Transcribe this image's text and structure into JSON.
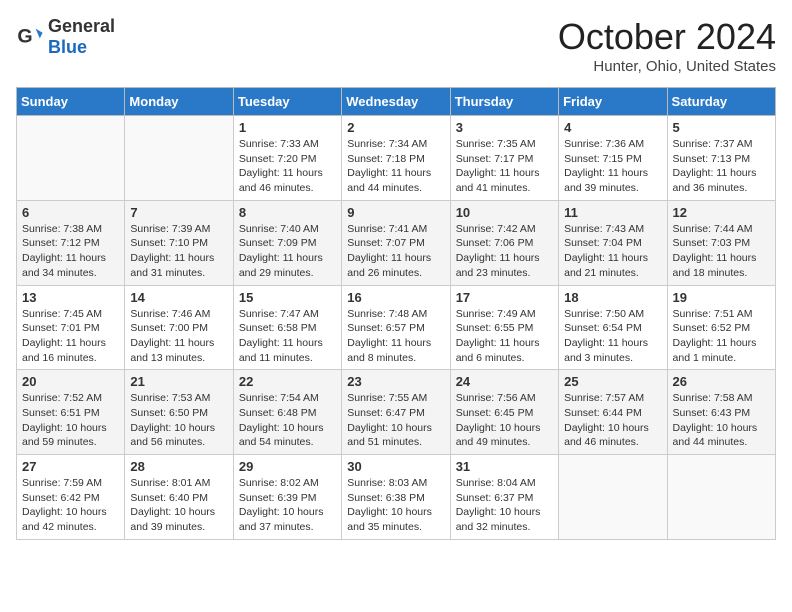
{
  "logo": {
    "general": "General",
    "blue": "Blue"
  },
  "header": {
    "month": "October 2024",
    "location": "Hunter, Ohio, United States"
  },
  "days_of_week": [
    "Sunday",
    "Monday",
    "Tuesday",
    "Wednesday",
    "Thursday",
    "Friday",
    "Saturday"
  ],
  "weeks": [
    [
      {
        "day": "",
        "info": ""
      },
      {
        "day": "",
        "info": ""
      },
      {
        "day": "1",
        "info": "Sunrise: 7:33 AM\nSunset: 7:20 PM\nDaylight: 11 hours and 46 minutes."
      },
      {
        "day": "2",
        "info": "Sunrise: 7:34 AM\nSunset: 7:18 PM\nDaylight: 11 hours and 44 minutes."
      },
      {
        "day": "3",
        "info": "Sunrise: 7:35 AM\nSunset: 7:17 PM\nDaylight: 11 hours and 41 minutes."
      },
      {
        "day": "4",
        "info": "Sunrise: 7:36 AM\nSunset: 7:15 PM\nDaylight: 11 hours and 39 minutes."
      },
      {
        "day": "5",
        "info": "Sunrise: 7:37 AM\nSunset: 7:13 PM\nDaylight: 11 hours and 36 minutes."
      }
    ],
    [
      {
        "day": "6",
        "info": "Sunrise: 7:38 AM\nSunset: 7:12 PM\nDaylight: 11 hours and 34 minutes."
      },
      {
        "day": "7",
        "info": "Sunrise: 7:39 AM\nSunset: 7:10 PM\nDaylight: 11 hours and 31 minutes."
      },
      {
        "day": "8",
        "info": "Sunrise: 7:40 AM\nSunset: 7:09 PM\nDaylight: 11 hours and 29 minutes."
      },
      {
        "day": "9",
        "info": "Sunrise: 7:41 AM\nSunset: 7:07 PM\nDaylight: 11 hours and 26 minutes."
      },
      {
        "day": "10",
        "info": "Sunrise: 7:42 AM\nSunset: 7:06 PM\nDaylight: 11 hours and 23 minutes."
      },
      {
        "day": "11",
        "info": "Sunrise: 7:43 AM\nSunset: 7:04 PM\nDaylight: 11 hours and 21 minutes."
      },
      {
        "day": "12",
        "info": "Sunrise: 7:44 AM\nSunset: 7:03 PM\nDaylight: 11 hours and 18 minutes."
      }
    ],
    [
      {
        "day": "13",
        "info": "Sunrise: 7:45 AM\nSunset: 7:01 PM\nDaylight: 11 hours and 16 minutes."
      },
      {
        "day": "14",
        "info": "Sunrise: 7:46 AM\nSunset: 7:00 PM\nDaylight: 11 hours and 13 minutes."
      },
      {
        "day": "15",
        "info": "Sunrise: 7:47 AM\nSunset: 6:58 PM\nDaylight: 11 hours and 11 minutes."
      },
      {
        "day": "16",
        "info": "Sunrise: 7:48 AM\nSunset: 6:57 PM\nDaylight: 11 hours and 8 minutes."
      },
      {
        "day": "17",
        "info": "Sunrise: 7:49 AM\nSunset: 6:55 PM\nDaylight: 11 hours and 6 minutes."
      },
      {
        "day": "18",
        "info": "Sunrise: 7:50 AM\nSunset: 6:54 PM\nDaylight: 11 hours and 3 minutes."
      },
      {
        "day": "19",
        "info": "Sunrise: 7:51 AM\nSunset: 6:52 PM\nDaylight: 11 hours and 1 minute."
      }
    ],
    [
      {
        "day": "20",
        "info": "Sunrise: 7:52 AM\nSunset: 6:51 PM\nDaylight: 10 hours and 59 minutes."
      },
      {
        "day": "21",
        "info": "Sunrise: 7:53 AM\nSunset: 6:50 PM\nDaylight: 10 hours and 56 minutes."
      },
      {
        "day": "22",
        "info": "Sunrise: 7:54 AM\nSunset: 6:48 PM\nDaylight: 10 hours and 54 minutes."
      },
      {
        "day": "23",
        "info": "Sunrise: 7:55 AM\nSunset: 6:47 PM\nDaylight: 10 hours and 51 minutes."
      },
      {
        "day": "24",
        "info": "Sunrise: 7:56 AM\nSunset: 6:45 PM\nDaylight: 10 hours and 49 minutes."
      },
      {
        "day": "25",
        "info": "Sunrise: 7:57 AM\nSunset: 6:44 PM\nDaylight: 10 hours and 46 minutes."
      },
      {
        "day": "26",
        "info": "Sunrise: 7:58 AM\nSunset: 6:43 PM\nDaylight: 10 hours and 44 minutes."
      }
    ],
    [
      {
        "day": "27",
        "info": "Sunrise: 7:59 AM\nSunset: 6:42 PM\nDaylight: 10 hours and 42 minutes."
      },
      {
        "day": "28",
        "info": "Sunrise: 8:01 AM\nSunset: 6:40 PM\nDaylight: 10 hours and 39 minutes."
      },
      {
        "day": "29",
        "info": "Sunrise: 8:02 AM\nSunset: 6:39 PM\nDaylight: 10 hours and 37 minutes."
      },
      {
        "day": "30",
        "info": "Sunrise: 8:03 AM\nSunset: 6:38 PM\nDaylight: 10 hours and 35 minutes."
      },
      {
        "day": "31",
        "info": "Sunrise: 8:04 AM\nSunset: 6:37 PM\nDaylight: 10 hours and 32 minutes."
      },
      {
        "day": "",
        "info": ""
      },
      {
        "day": "",
        "info": ""
      }
    ]
  ]
}
